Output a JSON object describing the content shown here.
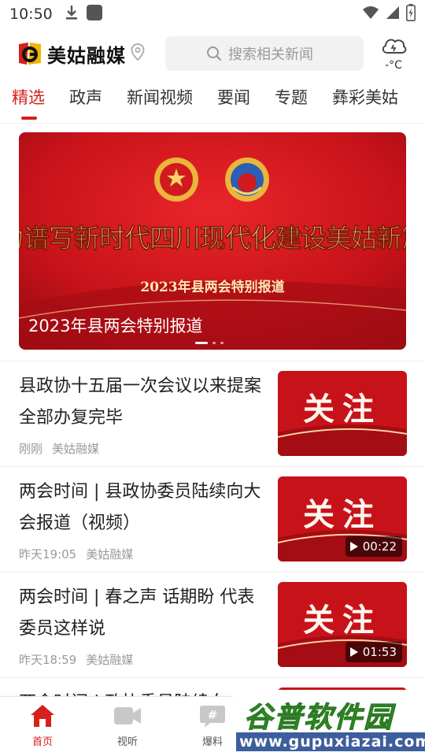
{
  "status_bar": {
    "time": "10:50"
  },
  "header": {
    "app_name": "美姑融媒",
    "search_placeholder": "搜索相关新闻",
    "weather_temp": "-°C"
  },
  "tabs": [
    {
      "label": "精选",
      "active": true
    },
    {
      "label": "政声"
    },
    {
      "label": "新闻视频"
    },
    {
      "label": "要闻"
    },
    {
      "label": "专题"
    },
    {
      "label": "彝彩美姑"
    }
  ],
  "banner": {
    "headline": "奋力谱写新时代四川现代化建设美姑新篇章",
    "subtitle": "2023年县两会特别报道",
    "caption": "2023年县两会特别报道",
    "slide_count": 3,
    "active_slide": 1
  },
  "news": [
    {
      "title": "县政协十五届一次会议以来提案全部办复完毕",
      "time": "刚刚",
      "source": "美姑融媒",
      "thumb_text": "关注",
      "duration": ""
    },
    {
      "title": "两会时间 | 县政协委员陆续向大会报道（视频）",
      "time": "昨天19:05",
      "source": "美姑融媒",
      "thumb_text": "关注",
      "duration": "00:22"
    },
    {
      "title": "两会时间 | 春之声 话期盼 代表委员这样说",
      "time": "昨天18:59",
      "source": "美姑融媒",
      "thumb_text": "关注",
      "duration": "01:53"
    },
    {
      "title": "两会时间 | 政协委员陆续向大",
      "time": "",
      "source": "",
      "thumb_text": "",
      "duration": ""
    }
  ],
  "bottom_nav": [
    {
      "label": "首页",
      "icon": "home-icon",
      "active": true
    },
    {
      "label": "视听",
      "icon": "video-camera-icon"
    },
    {
      "label": "爆料",
      "icon": "hashtag-chat-icon"
    }
  ],
  "watermark": {
    "title": "谷普软件园",
    "url": "www.gupuxiazai.com"
  },
  "colors": {
    "accent": "#d6201c",
    "banner_red": "#c8121a",
    "gold": "#f5d27a"
  }
}
